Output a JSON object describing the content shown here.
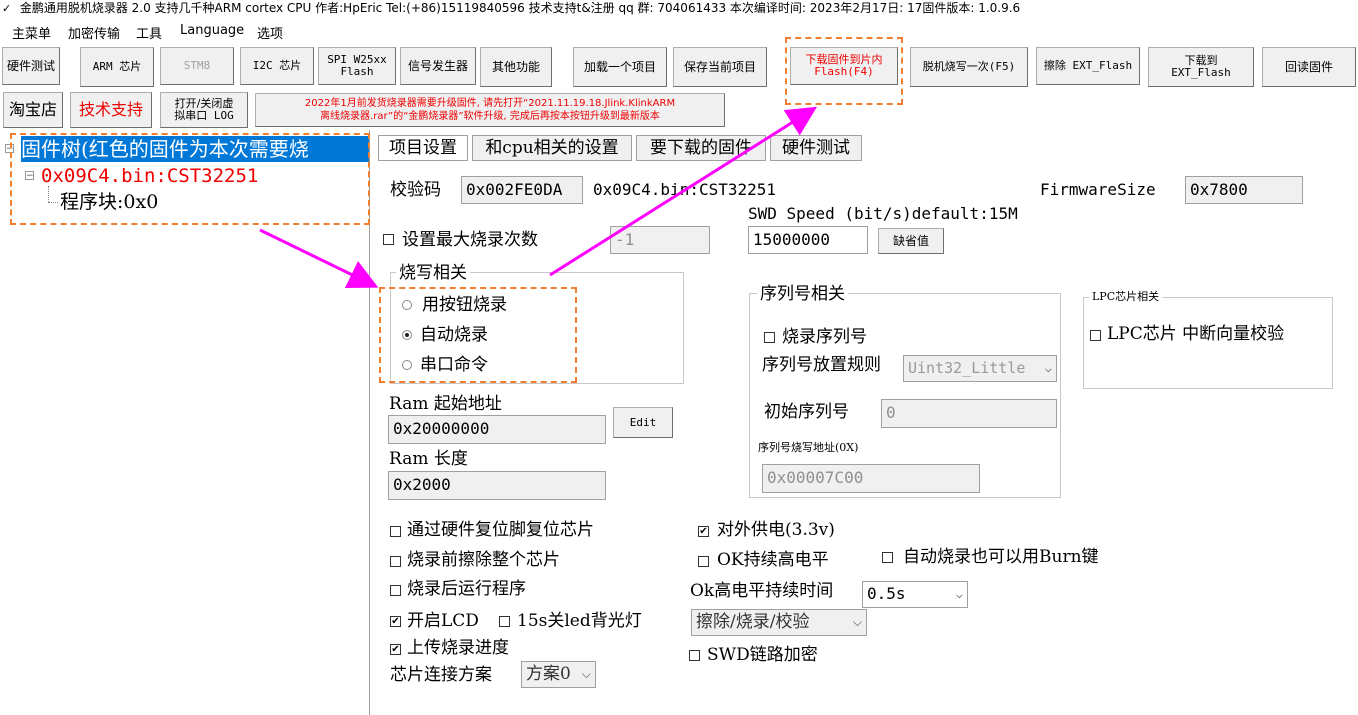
{
  "window": {
    "title": "金鹏通用脱机烧录器 2.0 支持几千种ARM cortex CPU 作者:HpEric  Tel:(+86)15119840596  技术支持t&注册 qq 群:  704061433  本次编译时间:  2023年2月17日: 17固件版本: 1.0.9.6"
  },
  "menu": [
    "主菜单",
    "加密传输",
    "工具",
    "Language",
    "选项"
  ],
  "toolbar1": {
    "hw_test": "硬件测试",
    "arm_chip": "ARM 芯片",
    "stm8": "STM8",
    "i2c_chip": "I2C 芯片",
    "spi_line1": "SPI W25xx",
    "spi_line2": "Flash",
    "signal_gen": "信号发生器",
    "other": "其他功能",
    "load_project": "加载一个项目",
    "save_project": "保存当前项目",
    "download_line1": "下载固件到片内",
    "download_line2": "Flash(F4)",
    "offline_once": "脱机烧写一次(F5)",
    "erase_ext": "擦除 EXT_Flash",
    "dl_ext_line1": "下载到",
    "dl_ext_line2": "EXT_Flash",
    "readback": "回读固件"
  },
  "toolbar2": {
    "taobao": "淘宝店",
    "support": "技术支持",
    "log_line1": "打开/关闭虚",
    "log_line2": "拟串口 LOG",
    "notice_line1": "2022年1月前发货烧录器需要升级固件, 请先打开“2021.11.19.18.Jlink.KlinkARM",
    "notice_line2": "离线烧录器.rar”的“金鹏烧录器”软件升级, 完成后再按本按钮升级到最新版本"
  },
  "tree": {
    "root": "固件树(红色的固件为本次需要烧",
    "file": "0x09C4.bin:CST32251",
    "block": "程序块:0x0"
  },
  "tabs": [
    "项目设置",
    "和cpu相关的设置",
    "要下载的固件",
    "硬件测试"
  ],
  "project": {
    "checksum_label": "校验码",
    "checksum_value": "0x002FE0DA",
    "firmware_name": "0x09C4.bin:CST32251",
    "fw_size_label": "FirmwareSize",
    "fw_size_value": "0x7800",
    "swd_speed_label": "SWD Speed (bit/s)default:15M",
    "swd_speed_value": "15000000",
    "default_btn": "缺省值",
    "max_burn_label": "设置最大烧录次数",
    "max_burn_value": "-1",
    "burn_group_title": "烧写相关",
    "radio_button": "用按钮烧录",
    "radio_auto": "自动烧录",
    "radio_serial": "串口命令",
    "ram_start_label": "Ram 起始地址",
    "ram_start_value": "0x20000000",
    "edit_btn": "Edit",
    "ram_len_label": "Ram 长度",
    "ram_len_value": "0x2000",
    "serial_group_title": "序列号相关",
    "burn_serial_label": "烧录序列号",
    "serial_rule_label": "序列号放置规则",
    "serial_rule_value": "Uint32_Little",
    "init_serial_label": "初始序列号",
    "init_serial_value": "0",
    "serial_addr_label": "序列号烧写地址(0X)",
    "serial_addr_value": "0x00007C00",
    "lpc_group_title": "LPC芯片相关",
    "lpc_vector_label": "LPC芯片 中断向量校验",
    "hw_reset_label": "通过硬件复位脚复位芯片",
    "erase_all_label": "烧录前擦除整个芯片",
    "run_after_label": "烧录后运行程序",
    "lcd_label": "开启LCD",
    "led_15s_label": "15s关led背光灯",
    "upload_progress_label": "上传烧录进度",
    "chip_conn_label": "芯片连接方案",
    "chip_conn_value": "方案0",
    "ext_power_label": "对外供电(3.3v)",
    "ok_high_label": "OK持续高电平",
    "auto_burn_key_label": "自动烧录也可以用Burn键",
    "ok_time_label": "Ok高电平持续时间",
    "ok_time_value": "0.5s",
    "op_mode_value": "擦除/烧录/校验",
    "swd_encrypt_label": "SWD链路加密"
  },
  "checks": {
    "max_burn": false,
    "burn_serial": false,
    "lpc_vector": false,
    "hw_reset": false,
    "erase_all": false,
    "run_after": false,
    "lcd": true,
    "led_15s": false,
    "upload_progress": true,
    "ext_power": true,
    "ok_high": false,
    "auto_burn_key": false,
    "swd_encrypt": false
  },
  "radio_selected": "auto",
  "colors": {
    "annotation": "#f08030",
    "arrow": "#ff00ff",
    "selection": "#0078d7",
    "highlight_text": "#e00000"
  }
}
